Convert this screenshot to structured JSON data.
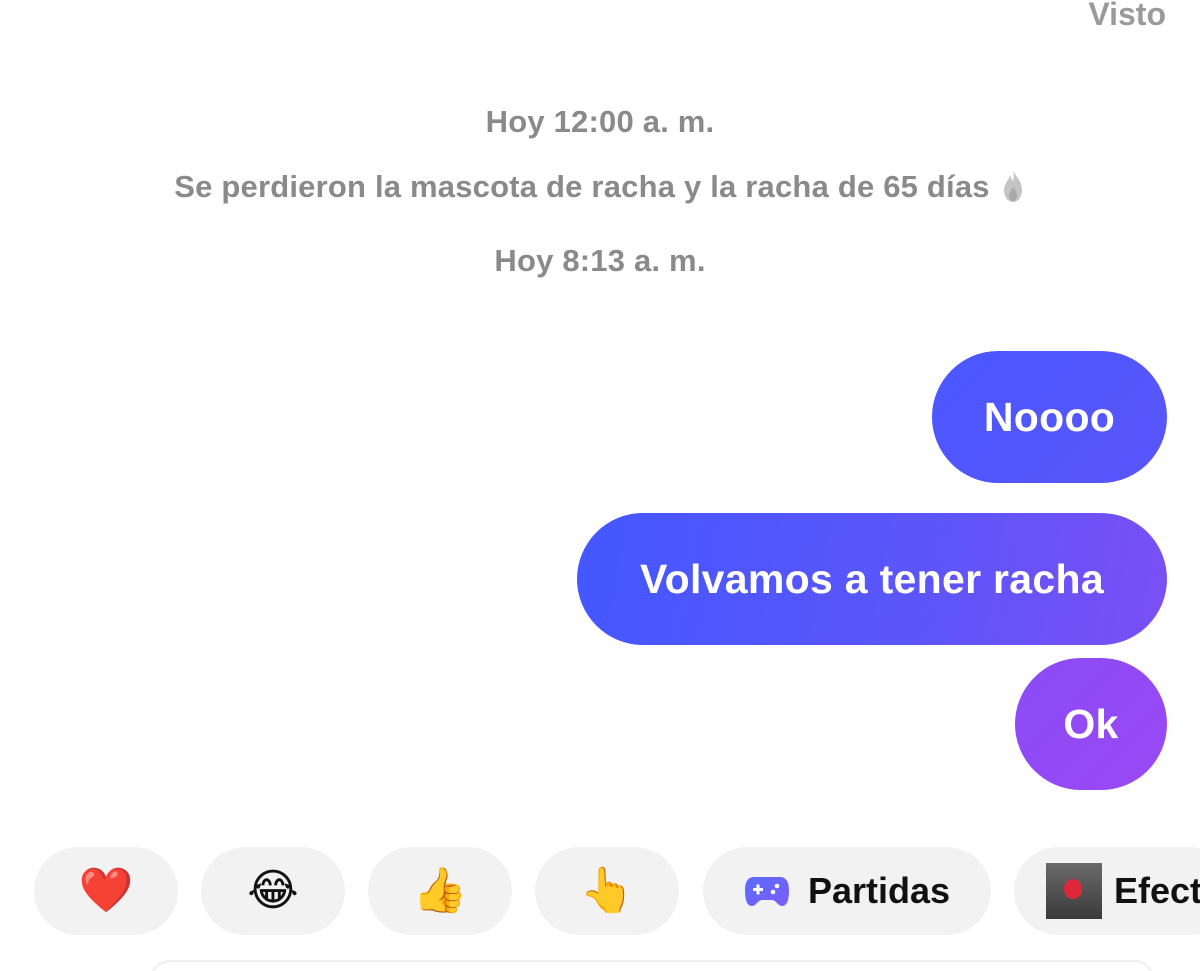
{
  "chat": {
    "seen_label": "Visto",
    "timestamp_1": "Hoy 12:00 a. m.",
    "system_message": "Se perdieron la mascota de racha y la racha de 65 días",
    "system_message_icon": "flame-icon",
    "timestamp_2": "Hoy 8:13 a. m.",
    "messages": [
      {
        "text": "Noooo",
        "sender": "me"
      },
      {
        "text": "Volvamos a tener racha",
        "sender": "me"
      },
      {
        "text": "Ok",
        "sender": "me"
      }
    ]
  },
  "quick_actions": {
    "items": [
      {
        "type": "reaction",
        "emoji": "❤️",
        "icon": "heart-emoji"
      },
      {
        "type": "reaction",
        "emoji": "😂",
        "icon": "laughing-emoji"
      },
      {
        "type": "reaction",
        "emoji": "👍",
        "icon": "thumbs-up-emoji"
      },
      {
        "type": "reaction",
        "emoji": "👆",
        "icon": "pointing-up-emoji"
      },
      {
        "type": "action",
        "label": "Partidas",
        "icon": "game-controller-icon"
      },
      {
        "type": "action",
        "label": "Efect",
        "icon": "effect-thumbnail"
      }
    ]
  },
  "colors": {
    "bubble_blue": "#4a57ff",
    "bubble_purple": "#9a48f4",
    "system_text": "#8a8a8a",
    "chip_background": "#f2f2f2"
  }
}
